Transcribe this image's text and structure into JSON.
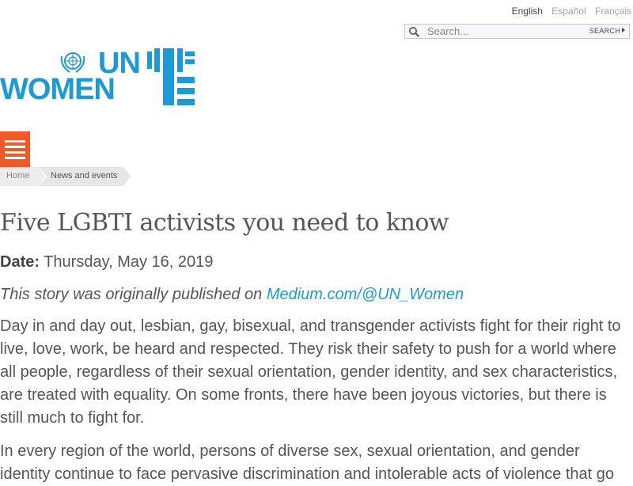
{
  "languages": [
    {
      "label": "English",
      "active": true
    },
    {
      "label": "Español",
      "active": false
    },
    {
      "label": "Français",
      "active": false
    }
  ],
  "search": {
    "placeholder": "Search...",
    "button_label": "SEARCH"
  },
  "logo": {
    "line1": "UN",
    "line2": "WOMEN",
    "color": "#1c9ad6"
  },
  "menu": {
    "icon": "hamburger-icon",
    "color": "#ee5a28"
  },
  "breadcrumb": [
    "Home",
    "News and events"
  ],
  "article": {
    "title": "Five LGBTI activists you need to know",
    "date_label": "Date:",
    "date_value": "Thursday, May 16, 2019",
    "source_prefix": "This story was originally published on ",
    "source_link": "Medium.com/@UN_Women",
    "paragraphs": [
      "Day in and day out, lesbian, gay, bisexual, and transgender activists fight for their right to live, love, work, be heard and respected. They risk their safety to push for a world where all people, regardless of their sexual orientation, gender identity, and sex characteristics, are treated with equality. On some fronts, there have been joyous victories, but there is still much to fight for.",
      "In every region of the world, persons of diverse sex, sexual orientation, and gender identity continue to face pervasive discrimination and intolerable acts of violence that go"
    ]
  }
}
